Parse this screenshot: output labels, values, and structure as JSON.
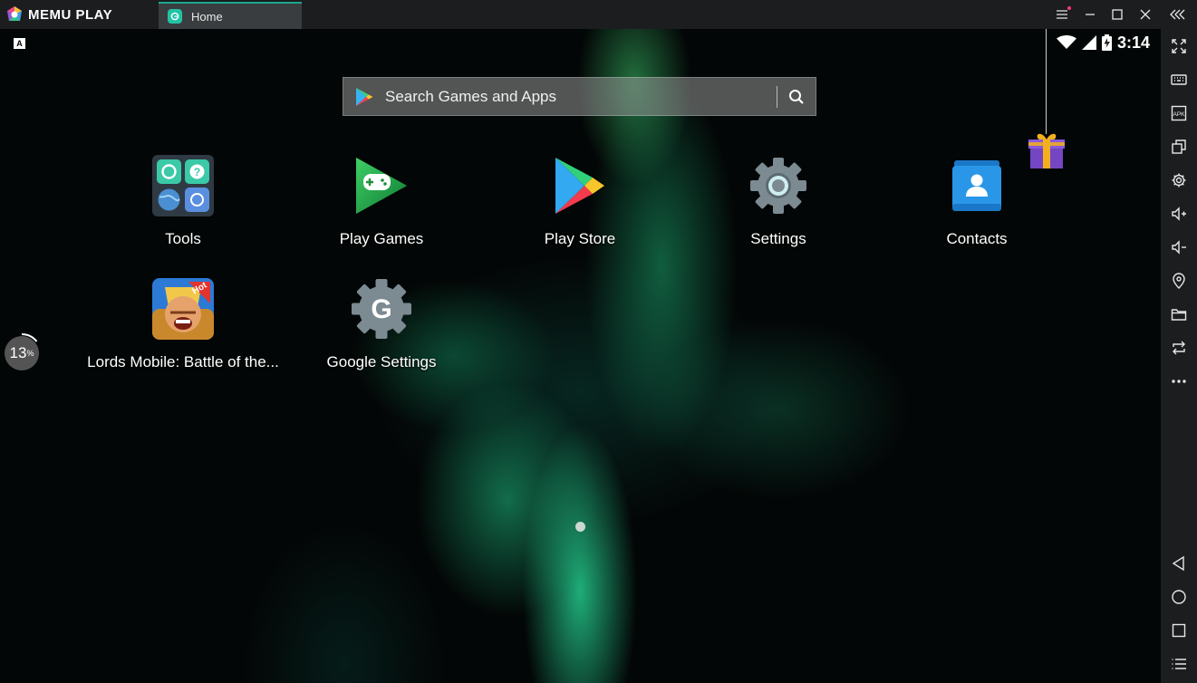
{
  "app": {
    "title": "MEMU PLAY"
  },
  "tab": {
    "label": "Home"
  },
  "status": {
    "time": "3:14",
    "keyboard_badge": "A"
  },
  "search": {
    "placeholder": "Search Games and Apps"
  },
  "apps": [
    {
      "label": "Tools",
      "icon": "tools-folder-icon"
    },
    {
      "label": "Play Games",
      "icon": "play-games-icon"
    },
    {
      "label": "Play Store",
      "icon": "play-store-icon"
    },
    {
      "label": "Settings",
      "icon": "settings-gear-icon"
    },
    {
      "label": "Contacts",
      "icon": "contacts-icon"
    },
    {
      "label": "Lords Mobile: Battle of the...",
      "icon": "lords-mobile-icon",
      "badge": "Hot"
    },
    {
      "label": "Google Settings",
      "icon": "google-settings-icon"
    }
  ],
  "progress": {
    "value": "13",
    "unit": "%"
  },
  "colors": {
    "accent": "#22c3a4",
    "titlebar": "#1c1d1f",
    "tab_active": "#3a3d40"
  }
}
